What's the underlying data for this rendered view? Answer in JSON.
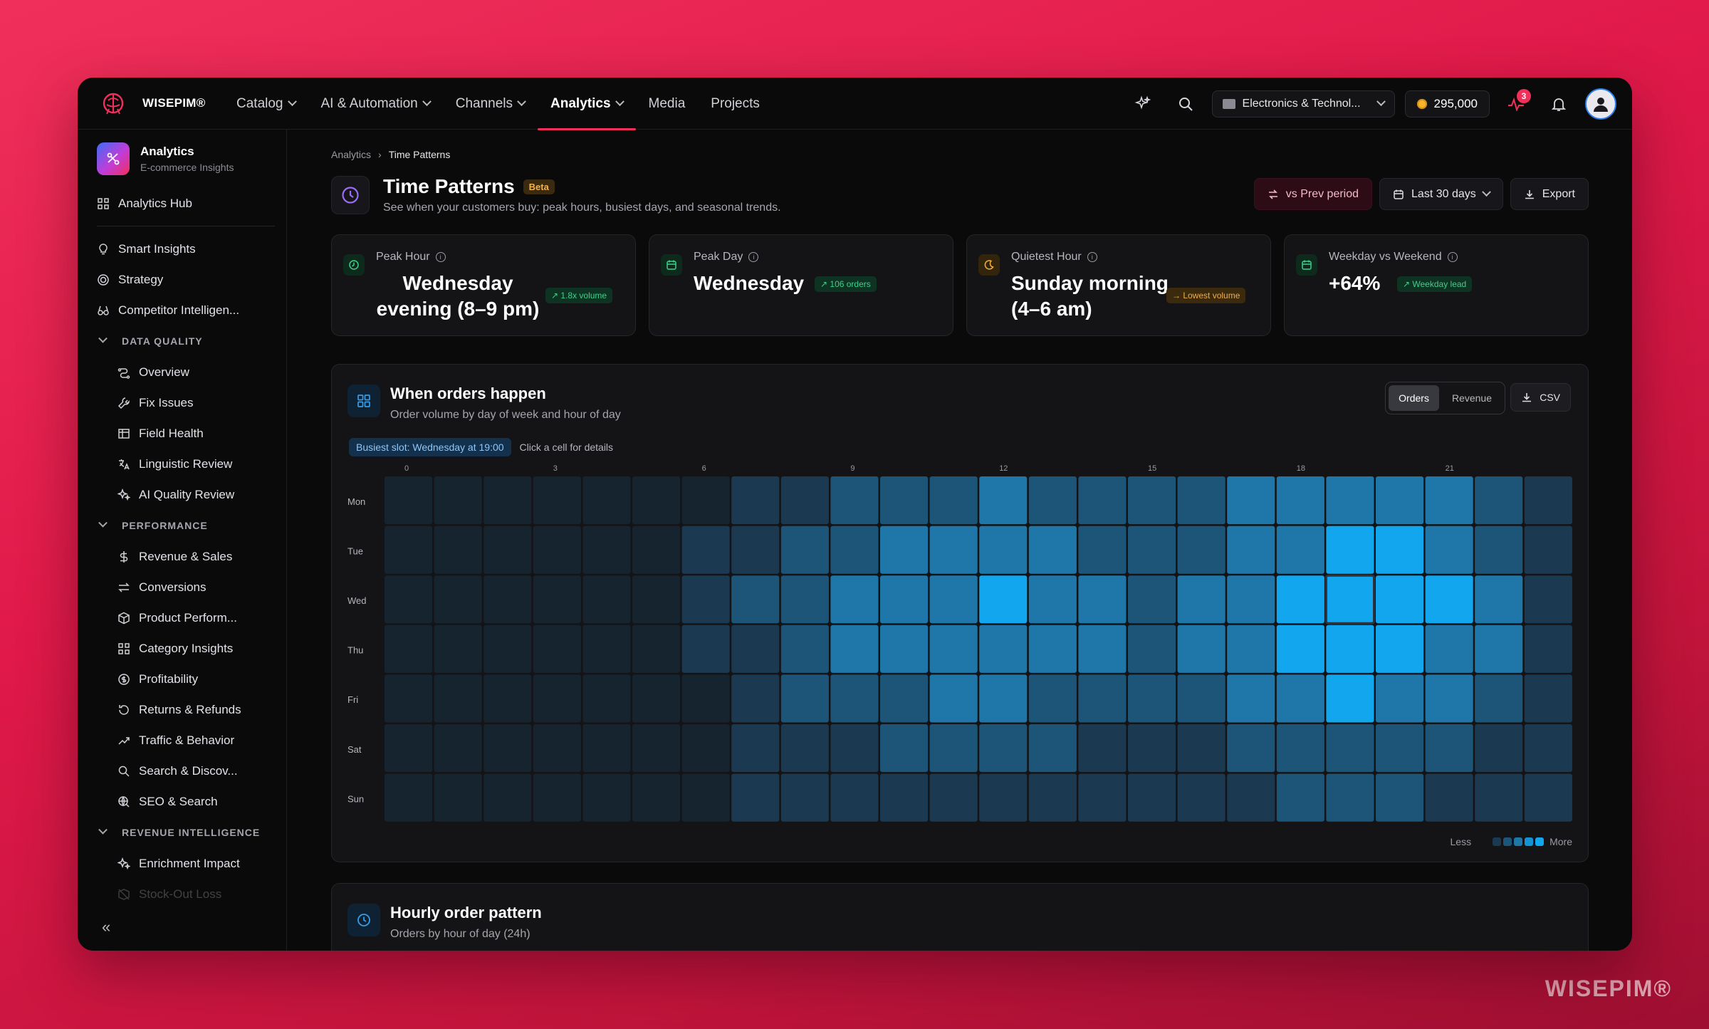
{
  "app": {
    "brand": "WISEPIM®",
    "watermark": "WISEPIM®"
  },
  "nav": {
    "items": [
      {
        "label": "Catalog",
        "dropdown": true
      },
      {
        "label": "AI & Automation",
        "dropdown": true
      },
      {
        "label": "Channels",
        "dropdown": true
      },
      {
        "label": "Analytics",
        "dropdown": true,
        "active": true
      },
      {
        "label": "Media",
        "dropdown": false
      },
      {
        "label": "Projects",
        "dropdown": false
      }
    ],
    "store": "Electronics & Technol...",
    "credits": "295,000",
    "activity_badge": "3"
  },
  "sidebar": {
    "title": "Analytics",
    "subtitle": "E-commerce Insights",
    "hub": "Analytics Hub",
    "top_items": [
      "Smart Insights",
      "Strategy",
      "Competitor Intelligen..."
    ],
    "sections": [
      {
        "label": "DATA QUALITY",
        "items": [
          "Overview",
          "Fix Issues",
          "Field Health",
          "Linguistic Review",
          "AI Quality Review"
        ]
      },
      {
        "label": "PERFORMANCE",
        "items": [
          "Revenue & Sales",
          "Conversions",
          "Product Perform...",
          "Category Insights",
          "Profitability",
          "Returns & Refunds",
          "Traffic & Behavior",
          "Search & Discov...",
          "SEO & Search"
        ]
      },
      {
        "label": "REVENUE INTELLIGENCE",
        "items": [
          "Enrichment Impact",
          "Stock-Out Loss"
        ]
      }
    ],
    "collapse": "«"
  },
  "page": {
    "breadcrumb": [
      "Analytics",
      "Time Patterns"
    ],
    "title": "Time Patterns",
    "badge": "Beta",
    "subtitle": "See when your customers buy: peak hours, busiest days, and seasonal trends.",
    "actions": {
      "compare": "vs Prev period",
      "range": "Last 30 days",
      "export": "Export"
    }
  },
  "kpis": [
    {
      "label": "Peak Hour",
      "value": "Wednesday evening (8–9 pm)",
      "tag": "↗ 1.8x volume",
      "tone": "green",
      "icon": "clock-icon"
    },
    {
      "label": "Peak Day",
      "value": "Wednesday",
      "tag": "↗ 106 orders",
      "tone": "green",
      "icon": "calendar-icon"
    },
    {
      "label": "Quietest Hour",
      "value": "Sunday morning (4–6 am)",
      "tag": "→ Lowest volume",
      "tone": "amber",
      "icon": "moon-icon"
    },
    {
      "label": "Weekday vs Weekend",
      "value": "+64%",
      "tag": "↗ Weekday lead",
      "tone": "green",
      "icon": "calendar-icon"
    }
  ],
  "heatmap_card": {
    "title": "When orders happen",
    "subtitle": "Order volume by day of week and hour of day",
    "toggle": [
      "Orders",
      "Revenue"
    ],
    "toggle_active": "Orders",
    "csv": "CSV",
    "busiest": "Busiest slot: Wednesday at 19:00",
    "hint": "Click a cell for details",
    "legend_less": "Less",
    "legend_more": "More",
    "legend_colors": [
      "#1b3a52",
      "#1d5578",
      "#1f76a8",
      "#1592d4",
      "#11a6ee"
    ]
  },
  "hourly_card": {
    "title": "Hourly order pattern",
    "subtitle": "Orders by hour of day (24h)"
  },
  "chart_data": {
    "type": "heatmap",
    "x_tick_labels": [
      "0",
      "3",
      "6",
      "9",
      "12",
      "15",
      "18",
      "21"
    ],
    "x_tick_hours": [
      0,
      3,
      6,
      9,
      12,
      15,
      18,
      21
    ],
    "hours": [
      0,
      1,
      2,
      3,
      4,
      5,
      6,
      7,
      8,
      9,
      10,
      11,
      12,
      13,
      14,
      15,
      16,
      17,
      18,
      19,
      20,
      21,
      22,
      23
    ],
    "days": [
      "Mon",
      "Tue",
      "Wed",
      "Thu",
      "Fri",
      "Sat",
      "Sun"
    ],
    "intensity": [
      [
        0,
        0,
        0,
        0,
        0,
        0,
        0,
        1,
        1,
        2,
        2,
        2,
        3,
        2,
        2,
        2,
        2,
        3,
        3,
        3,
        3,
        3,
        2,
        1
      ],
      [
        0,
        0,
        0,
        0,
        0,
        0,
        1,
        1,
        2,
        2,
        3,
        3,
        3,
        3,
        2,
        2,
        2,
        3,
        3,
        4,
        4,
        3,
        2,
        1
      ],
      [
        0,
        0,
        0,
        0,
        0,
        0,
        1,
        2,
        2,
        3,
        3,
        3,
        4,
        3,
        3,
        2,
        3,
        3,
        4,
        4,
        4,
        4,
        3,
        1
      ],
      [
        0,
        0,
        0,
        0,
        0,
        0,
        1,
        1,
        2,
        3,
        3,
        3,
        3,
        3,
        3,
        2,
        3,
        3,
        4,
        4,
        4,
        3,
        3,
        1
      ],
      [
        0,
        0,
        0,
        0,
        0,
        0,
        0,
        1,
        2,
        2,
        2,
        3,
        3,
        2,
        2,
        2,
        2,
        3,
        3,
        4,
        3,
        3,
        2,
        1
      ],
      [
        0,
        0,
        0,
        0,
        0,
        0,
        0,
        1,
        1,
        1,
        2,
        2,
        2,
        2,
        1,
        1,
        1,
        2,
        2,
        2,
        2,
        2,
        1,
        1
      ],
      [
        0,
        0,
        0,
        0,
        0,
        0,
        0,
        1,
        1,
        1,
        1,
        1,
        1,
        1,
        1,
        1,
        1,
        1,
        2,
        2,
        2,
        1,
        1,
        1
      ]
    ],
    "intensity_scale": "0 = lowest, 4 = highest",
    "highlighted_cell": {
      "day": "Wed",
      "hour": 19
    }
  }
}
